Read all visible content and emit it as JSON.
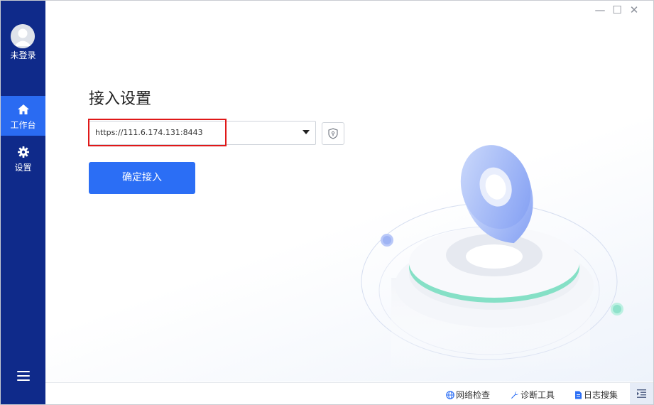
{
  "sidebar": {
    "login_status": "未登录",
    "items": [
      {
        "label": "工作台",
        "icon": "home-icon",
        "active": true
      },
      {
        "label": "设置",
        "icon": "gear-icon",
        "active": false
      }
    ],
    "menu_icon": "hamburger-menu-icon"
  },
  "window_controls": {
    "minimize": "—",
    "maximize": "☐",
    "close": "✕"
  },
  "main": {
    "title": "接入设置",
    "url": {
      "value": "https://111.6.174.131:8443"
    },
    "confirm_label": "确定接入"
  },
  "bottombar": {
    "items": [
      {
        "label": "网络检查",
        "icon": "globe-icon"
      },
      {
        "label": "诊断工具",
        "icon": "wrench-icon"
      },
      {
        "label": "日志搜集",
        "icon": "document-icon"
      }
    ]
  },
  "colors": {
    "sidebar": "#0f2a8a",
    "active": "#2a6bf2",
    "button": "#2b6ef5",
    "highlight": "#e01818"
  }
}
